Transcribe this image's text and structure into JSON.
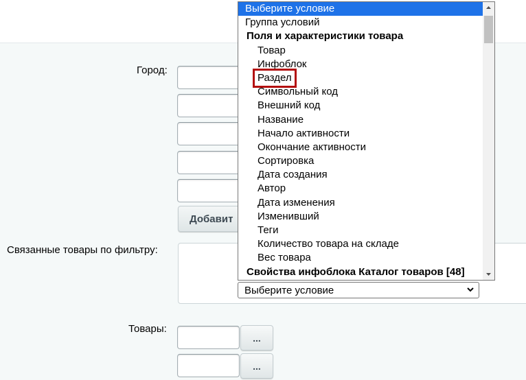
{
  "form": {
    "city_label": "Город:",
    "add_button_label": "Добавит",
    "related_filter_label": "Связанные товары по фильтру:",
    "filter_select_value": "Выберите условие",
    "products_label": "Товары:",
    "dots_label": "..."
  },
  "dropdown": {
    "selected": "Выберите условие",
    "group_conditions": "Группа условий",
    "group_product_fields": "Поля и характеристики товара",
    "items": [
      "Товар",
      "Инфоблок",
      "Раздел",
      "Символьный код",
      "Внешний код",
      "Название",
      "Начало активности",
      "Окончание активности",
      "Сортировка",
      "Дата создания",
      "Автор",
      "Дата изменения",
      "Изменивший",
      "Теги",
      "Количество товара на складе",
      "Вес товара"
    ],
    "highlighted_item": "Раздел",
    "group_iblock_props": "Свойства инфоблока Каталог товаров [48]"
  },
  "colors": {
    "selection": "#1e72e8",
    "highlight_border": "#b30e0e"
  }
}
